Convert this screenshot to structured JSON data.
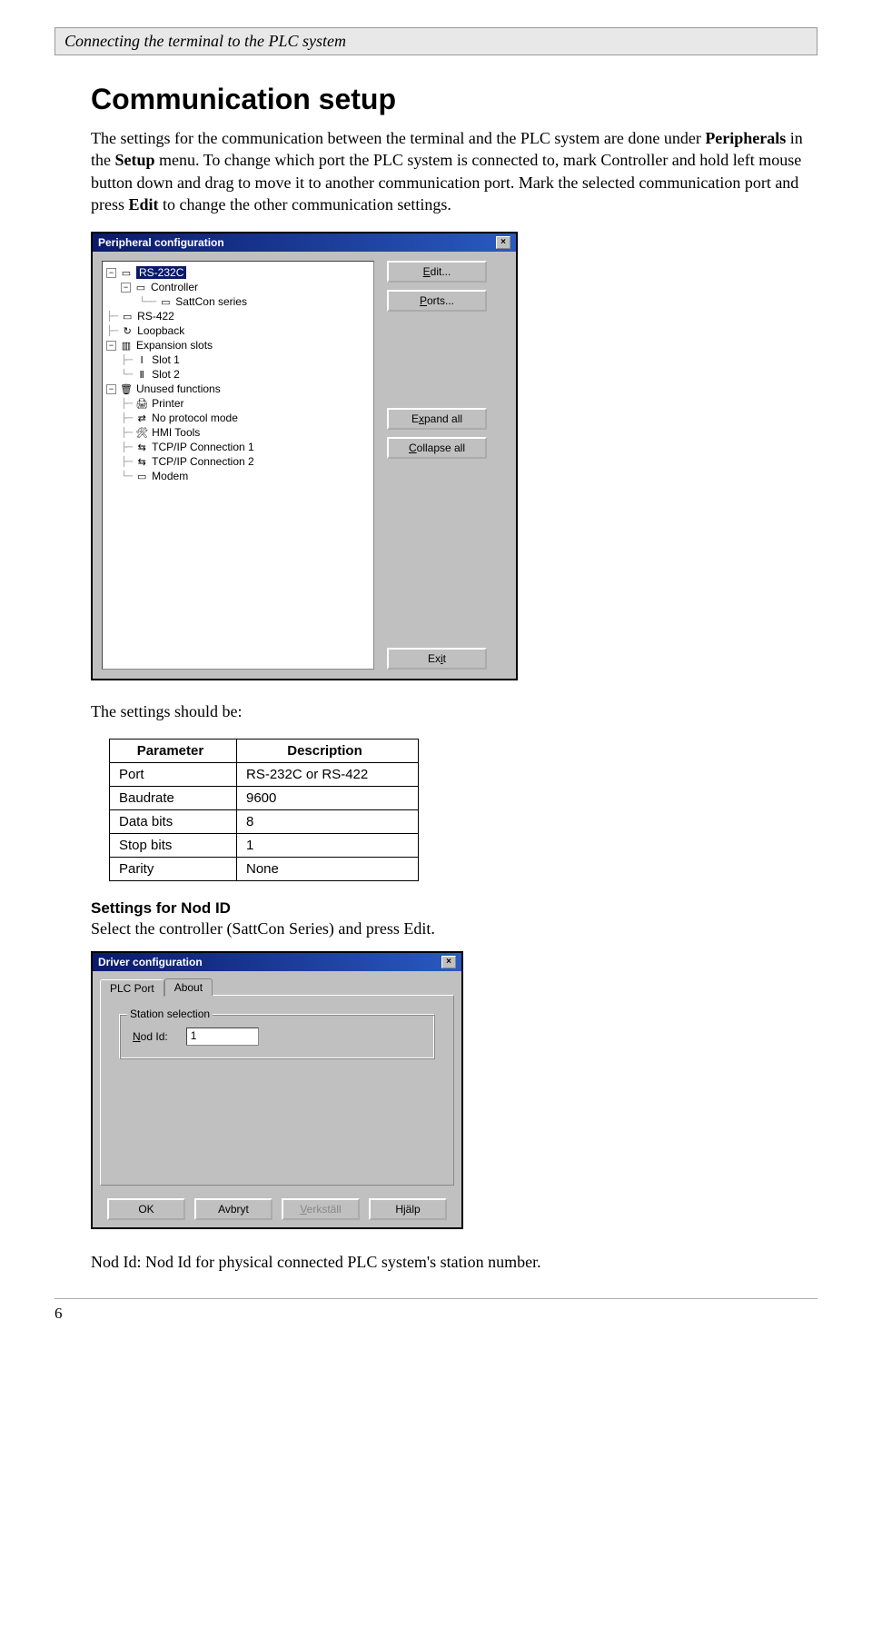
{
  "header": "Connecting the terminal to the PLC system",
  "section_title": "Communication setup",
  "para1_parts": {
    "a": "The settings for the communication between the terminal and the PLC system are done under ",
    "b": "Peripherals",
    "c": " in the ",
    "d": "Setup",
    "e": " menu. To change which port the PLC system is connected to, mark Controller and hold left mouse button down and drag to move it to another communication port. Mark the selected communication port and press ",
    "f": "Edit",
    "g": " to change the other communication settings."
  },
  "dialog1": {
    "title": "Peripheral configuration",
    "tree": {
      "rs232c": "RS-232C",
      "controller": "Controller",
      "sattcon": "SattCon series",
      "rs422": "RS-422",
      "loopback": "Loopback",
      "expansion": "Expansion slots",
      "slot1": "Slot 1",
      "slot2": "Slot 2",
      "unused": "Unused functions",
      "printer": "Printer",
      "noprot": "No protocol mode",
      "hmi": "HMI Tools",
      "tcp1": "TCP/IP Connection 1",
      "tcp2": "TCP/IP Connection 2",
      "modem": "Modem"
    },
    "buttons": {
      "edit": "Edit...",
      "ports": "Ports...",
      "expand": "Expand all",
      "collapse": "Collapse all",
      "exit": "Exit"
    }
  },
  "settings_intro": "The settings should be:",
  "table": {
    "h1": "Parameter",
    "h2": "Description",
    "rows": [
      {
        "p": "Port",
        "d": "RS-232C or RS-422"
      },
      {
        "p": "Baudrate",
        "d": "9600"
      },
      {
        "p": "Data bits",
        "d": "8"
      },
      {
        "p": "Stop bits",
        "d": "1"
      },
      {
        "p": "Parity",
        "d": "None"
      }
    ]
  },
  "nod_heading": "Settings for Nod ID",
  "nod_text": "Select the controller (SattCon Series) and press Edit.",
  "dialog2": {
    "title": "Driver configuration",
    "tab1": "PLC Port",
    "tab2": "About",
    "group": "Station selection",
    "field_label": "Nod Id:",
    "field_value": "1",
    "ok": "OK",
    "cancel": "Avbryt",
    "apply": "Verkställ",
    "help": "Hjälp"
  },
  "footer_text": "Nod Id: Nod Id for physical connected PLC system's station number.",
  "page_number": "6"
}
